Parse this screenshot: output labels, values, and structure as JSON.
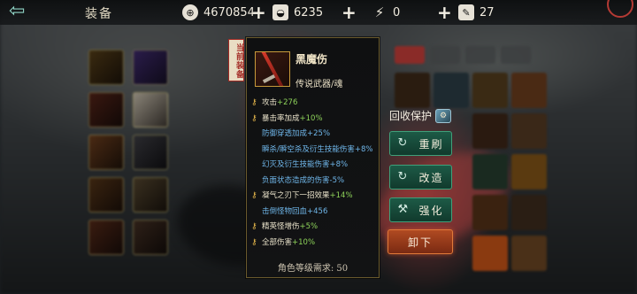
{
  "topbar": {
    "title": "装备",
    "back_icon": "back-arrow-icon",
    "currencies": [
      {
        "name": "coins",
        "icon": "coin-icon",
        "value": "4670854"
      },
      {
        "name": "ingots",
        "icon": "ingot-icon",
        "value": "6235"
      },
      {
        "name": "energy",
        "icon": "lightning-icon",
        "value": "0"
      },
      {
        "name": "tickets",
        "icon": "ticket-icon",
        "value": "27"
      }
    ]
  },
  "item": {
    "equipped_tag": "当前装备",
    "name": "黑魔伤",
    "rarity": "传说武器/魂",
    "stats": [
      {
        "label": "攻击",
        "value": "+276",
        "style": "gold"
      },
      {
        "label": "暴击率加成",
        "value": "+10%",
        "style": "gold"
      },
      {
        "label": "防御穿透加成+25%",
        "value": "",
        "style": "blue-indent"
      },
      {
        "label": "瞬杀/瞬空杀及衍生技能伤害+8%",
        "value": "",
        "style": "blue-indent"
      },
      {
        "label": "幻灭及衍生技能伤害+8%",
        "value": "",
        "style": "blue-indent"
      },
      {
        "label": "负面状态造成的伤害-5%",
        "value": "",
        "style": "blue-indent"
      },
      {
        "label": "凝气之刃下一招效果",
        "value": "+14%",
        "style": "gold"
      },
      {
        "label": "击倒怪物回血+456",
        "value": "",
        "style": "blue-indent"
      },
      {
        "label": "精英怪增伤",
        "value": "+5%",
        "style": "gold"
      },
      {
        "label": "全部伤害",
        "value": "+10%",
        "style": "gold"
      }
    ],
    "requirement": "角色等级需求: 50"
  },
  "actions": {
    "protect_label": "回收保护",
    "reforge_label": "重刷",
    "modify_label": "改造",
    "enhance_label": "强化",
    "unequip_label": "卸下"
  },
  "colors": {
    "accent_green": "#3fa07a",
    "unequip_orange": "#b04a22",
    "stat_green": "#8ed35a",
    "stat_blue": "#6fb6e9"
  }
}
